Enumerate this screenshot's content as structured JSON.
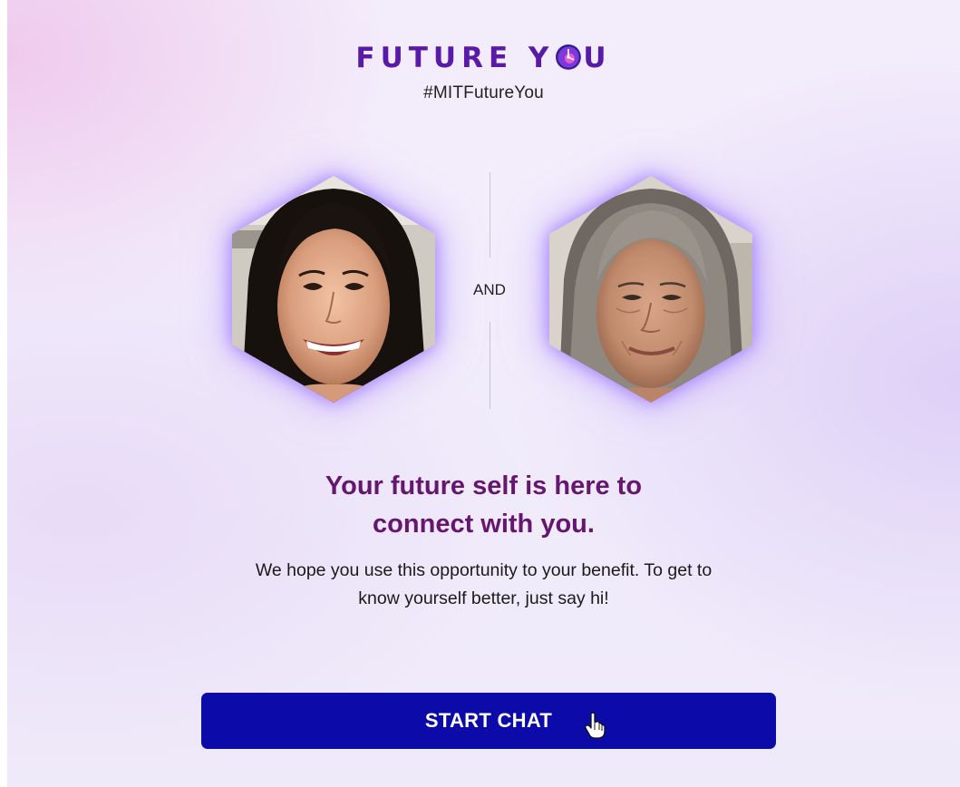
{
  "header": {
    "logo_before": "FUTURE Y",
    "logo_after": "U",
    "hashtag": "#MITFutureYou"
  },
  "comparison": {
    "and_label": "AND"
  },
  "headline": {
    "line1": "Your future self is here to",
    "line2": "connect with you."
  },
  "subtext": {
    "line1": "We hope you use this opportunity to your benefit. To get to",
    "line2": "know yourself better, just say hi!"
  },
  "cta": {
    "label": "START CHAT"
  },
  "colors": {
    "logo": "#5a1aa8",
    "headline": "#65166e",
    "button": "#0c0aa8",
    "glow": "#9a78ff"
  },
  "icons": {
    "logo_o": "clock-globe-icon",
    "cursor": "hand-pointer-icon"
  }
}
